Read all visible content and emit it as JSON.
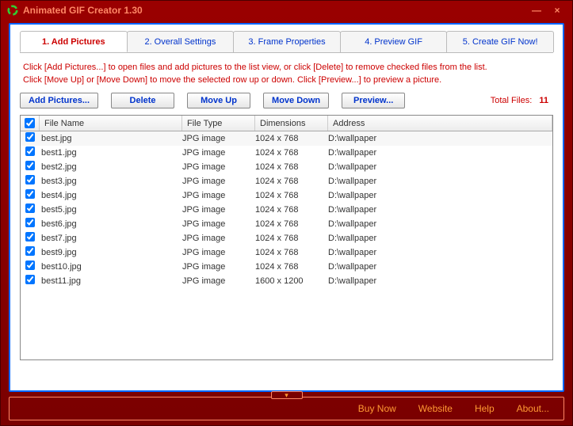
{
  "titlebar": {
    "title": "Animated GIF Creator 1.30"
  },
  "tabs": [
    {
      "label": "1. Add Pictures",
      "active": true
    },
    {
      "label": "2. Overall Settings",
      "active": false
    },
    {
      "label": "3. Frame Properties",
      "active": false
    },
    {
      "label": "4. Preview GIF",
      "active": false
    },
    {
      "label": "5. Create GIF Now!",
      "active": false
    }
  ],
  "instructions": {
    "line1": "Click [Add Pictures...] to open files and add pictures to the list view, or click [Delete] to remove checked files from the list.",
    "line2": "Click [Move Up] or [Move Down] to move the selected row up or down. Click [Preview...] to preview a picture."
  },
  "toolbar": {
    "add_label": "Add Pictures...",
    "delete_label": "Delete",
    "moveup_label": "Move Up",
    "movedown_label": "Move Down",
    "preview_label": "Preview...",
    "total_label": "Total Files:",
    "total_count": "11"
  },
  "columns": {
    "name": "File Name",
    "type": "File Type",
    "dim": "Dimensions",
    "addr": "Address"
  },
  "rows": [
    {
      "name": "best.jpg",
      "type": "JPG image",
      "dim": "1024 x 768",
      "addr": "D:\\wallpaper"
    },
    {
      "name": "best1.jpg",
      "type": "JPG image",
      "dim": "1024 x 768",
      "addr": "D:\\wallpaper"
    },
    {
      "name": "best2.jpg",
      "type": "JPG image",
      "dim": "1024 x 768",
      "addr": "D:\\wallpaper"
    },
    {
      "name": "best3.jpg",
      "type": "JPG image",
      "dim": "1024 x 768",
      "addr": "D:\\wallpaper"
    },
    {
      "name": "best4.jpg",
      "type": "JPG image",
      "dim": "1024 x 768",
      "addr": "D:\\wallpaper"
    },
    {
      "name": "best5.jpg",
      "type": "JPG image",
      "dim": "1024 x 768",
      "addr": "D:\\wallpaper"
    },
    {
      "name": "best6.jpg",
      "type": "JPG image",
      "dim": "1024 x 768",
      "addr": "D:\\wallpaper"
    },
    {
      "name": "best7.jpg",
      "type": "JPG image",
      "dim": "1024 x 768",
      "addr": "D:\\wallpaper"
    },
    {
      "name": "best9.jpg",
      "type": "JPG image",
      "dim": "1024 x 768",
      "addr": "D:\\wallpaper"
    },
    {
      "name": "best10.jpg",
      "type": "JPG image",
      "dim": "1024 x 768",
      "addr": "D:\\wallpaper"
    },
    {
      "name": "best11.jpg",
      "type": "JPG image",
      "dim": "1600 x 1200",
      "addr": "D:\\wallpaper"
    }
  ],
  "footer": {
    "buynow": "Buy Now",
    "website": "Website",
    "help": "Help",
    "about": "About..."
  }
}
